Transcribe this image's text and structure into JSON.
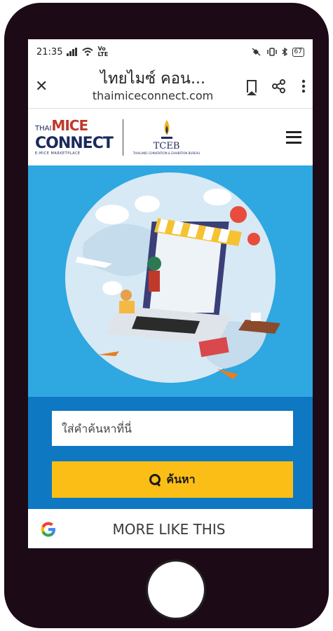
{
  "status_bar": {
    "time": "21:35",
    "net_badge_top": "Vo",
    "net_badge_bottom": "LTE",
    "battery": "67"
  },
  "browser": {
    "close_label": "✕",
    "page_title": "ไทยไมซ์ คอน...",
    "domain": "thaimiceconnect.com"
  },
  "site_header": {
    "logo_small": "THAI",
    "logo_mice": "MICE",
    "logo_connect": "CONNECT",
    "logo_tagline": "E-MICE MARKETPLACE",
    "tceb_name": "TCEB",
    "tceb_sub": "THAILAND CONVENTION & EXHIBITION BUREAU"
  },
  "search": {
    "placeholder": "ใส่คำค้นหาที่นี่",
    "button_label": "ค้นหา"
  },
  "more_bar": {
    "google_letter": "G",
    "label": "MORE LIKE THIS"
  },
  "colors": {
    "hero_bg": "#2fa7e0",
    "search_panel_bg": "#0e78c2",
    "search_button": "#fbbe16",
    "phone_frame": "#1d0a17"
  }
}
